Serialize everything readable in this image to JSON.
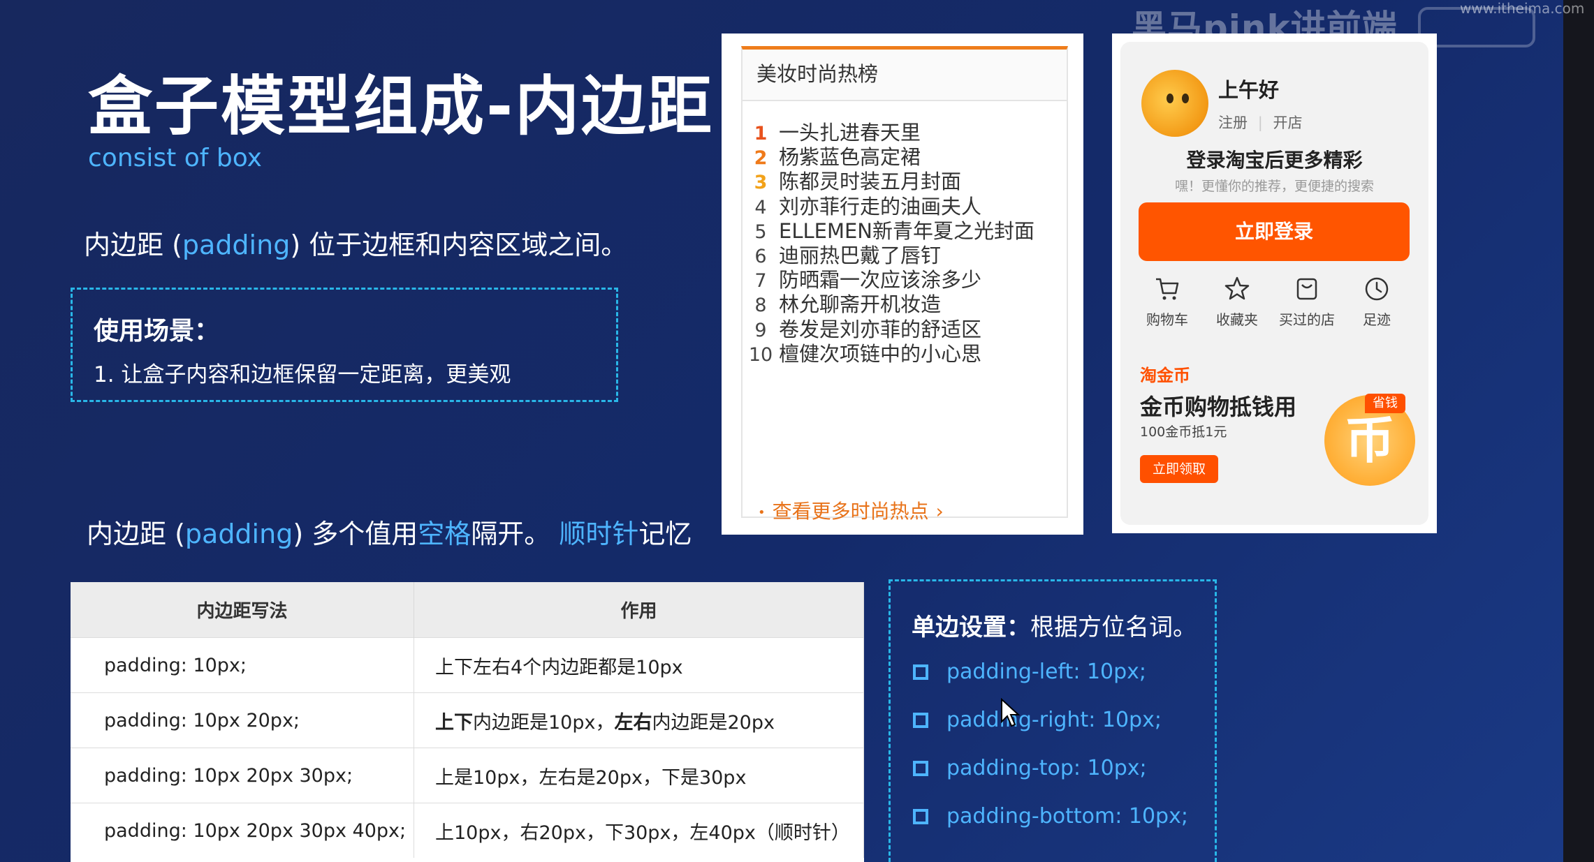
{
  "watermark": {
    "brand": "黑马pink讲前端",
    "site": "www.itheima.com"
  },
  "slide": {
    "title": "盒子模型组成-内边距",
    "subtitle": "consist of box",
    "intro": {
      "pre": "内边距 (",
      "kw": "padding",
      "post": ") 位于边框和内容区域之间。"
    },
    "usage": {
      "heading": "使用场景：",
      "text": "1. 让盒子内容和边框保留一定距离，更美观"
    },
    "sentence2": {
      "a": "内边距 (",
      "b": "padding",
      "c": ") 多个值用",
      "d": "空格",
      "e": "隔开。 ",
      "f": "顺时针",
      "g": "记忆"
    }
  },
  "table": {
    "headers": [
      "内边距写法",
      "作用"
    ],
    "rows": [
      {
        "code": "padding: 10px;",
        "effect": [
          {
            "t": "上下左右4个内边距都是10px",
            "b": false
          }
        ]
      },
      {
        "code": "padding: 10px 20px;",
        "effect": [
          {
            "t": "上下",
            "b": true
          },
          {
            "t": "内边距是10px，",
            "b": false
          },
          {
            "t": "左右",
            "b": true
          },
          {
            "t": "内边距是20px",
            "b": false
          }
        ]
      },
      {
        "code": "padding: 10px 20px 30px;",
        "effect": [
          {
            "t": "上是10px，左右是20px，下是30px",
            "b": false
          }
        ]
      },
      {
        "code": "padding:  10px 20px 30px 40px;",
        "effect": [
          {
            "t": "上10px，右20px，下30px，左40px（顺时针）",
            "b": false
          }
        ]
      }
    ]
  },
  "single_side": {
    "heading_bold": "单边设置：",
    "heading_rest": "根据方位名词。",
    "items": [
      "padding-left: 10px;",
      "padding-right: 10px;",
      "padding-top: 10px;",
      "padding-bottom: 10px;"
    ]
  },
  "ranking": {
    "title": "美妆时尚热榜",
    "items": [
      {
        "num": "1",
        "text": "一头扎进春天里",
        "color": "#e8521d"
      },
      {
        "num": "2",
        "text": "杨紫蓝色高定裙",
        "color": "#ef7a1a"
      },
      {
        "num": "3",
        "text": "陈都灵时装五月封面",
        "color": "#f2a21a"
      },
      {
        "num": "4",
        "text": "刘亦菲行走的油画夫人",
        "color": "#444444"
      },
      {
        "num": "5",
        "text": "ELLEMEN新青年夏之光封面",
        "color": "#444444"
      },
      {
        "num": "6",
        "text": "迪丽热巴戴了唇钉",
        "color": "#444444"
      },
      {
        "num": "7",
        "text": "防晒霜一次应该涂多少",
        "color": "#444444"
      },
      {
        "num": "8",
        "text": "林允聊斋开机妆造",
        "color": "#444444"
      },
      {
        "num": "9",
        "text": "卷发是刘亦菲的舒适区",
        "color": "#444444"
      },
      {
        "num": "10",
        "text": "檀健次项链中的小心思",
        "color": "#444444"
      }
    ],
    "more": "查看更多时尚热点"
  },
  "taobao": {
    "greeting": "上午好",
    "link_register": "注册",
    "link_shop": "开店",
    "login_title": "登录淘宝后更多精彩",
    "login_sub": "嘿！更懂你的推荐，更便捷的搜索",
    "login_btn": "立即登录",
    "quick": [
      {
        "label": "购物车",
        "icon": "cart-icon"
      },
      {
        "label": "收藏夹",
        "icon": "star-icon"
      },
      {
        "label": "买过的店",
        "icon": "shop-bag-icon"
      },
      {
        "label": "足迹",
        "icon": "clock-icon"
      }
    ],
    "coin_brand": "淘金币",
    "coin_title": "金币购物抵钱用",
    "coin_sub": "100金币抵1元",
    "coin_btn": "立即领取",
    "coin_tag": "省钱",
    "coin_glyph": "币",
    "accent": "#ff5000"
  }
}
